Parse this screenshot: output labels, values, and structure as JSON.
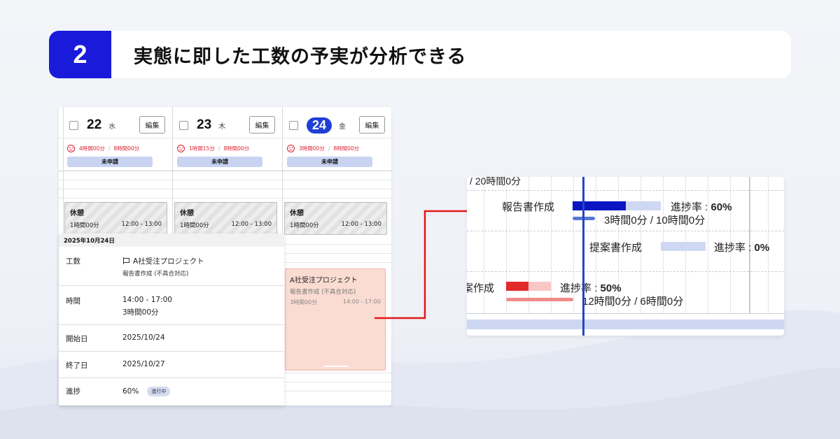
{
  "banner": {
    "number": "2",
    "title": "実態に即した工数の予実が分析できる"
  },
  "calendar": {
    "days": [
      {
        "num": "22",
        "dow": "水",
        "edit": "編集",
        "actual": "4時間00分",
        "planned": "8時間00分",
        "status": "未申請",
        "today": false
      },
      {
        "num": "23",
        "dow": "木",
        "edit": "編集",
        "actual": "1時間15分",
        "planned": "8時間00分",
        "status": "未申請",
        "today": false
      },
      {
        "num": "24",
        "dow": "金",
        "edit": "編集",
        "actual": "3時間00分",
        "planned": "8時間00分",
        "status": "未申請",
        "today": true
      }
    ],
    "rest": {
      "title": "休憩",
      "duration": "1時間00分",
      "range": "12:00 - 13:00"
    },
    "task": {
      "project": "A社受注プロジェクト",
      "name": "報告書作成 (不具合対応)",
      "duration": "3時間00分",
      "range": "14:00 - 17:00"
    }
  },
  "detail": {
    "date": "2025年10月24日",
    "rows": {
      "kosu": {
        "label": "工数",
        "project": "A社受注プロジェクト",
        "task": "報告書作成 (不具合対応)"
      },
      "time": {
        "label": "時間",
        "range": "14:00 - 17:00",
        "duration": "3時間00分"
      },
      "start": {
        "label": "開始日",
        "value": "2025/10/24"
      },
      "end": {
        "label": "終了日",
        "value": "2025/10/27"
      },
      "progress": {
        "label": "進捗",
        "value": "60%",
        "badge": "進行中"
      }
    }
  },
  "gantt": {
    "top_cut": "/ 20時間0分",
    "tasks": [
      {
        "name": "報告書作成",
        "progress_label": "進捗率 : ",
        "progress_value": "60%",
        "hours": "3時間0分 / 10時間0分",
        "progress": 0.6,
        "color": "#0a16c2",
        "track": "#cfd8f2",
        "sub": "#5578d6"
      },
      {
        "name": "提案書作成",
        "progress_label": "進捗率 : ",
        "progress_value": "0%",
        "progress": 0.0,
        "color": "#0a16c2",
        "track": "#cfd8f2"
      },
      {
        "name": "案作成",
        "progress_label": "進捗率 : ",
        "progress_value": "50%",
        "hours": "12時間0分 / 6時間0分",
        "progress": 0.5,
        "color": "#e22a2a",
        "track": "#f8c8c8",
        "sub": "#f08b8b"
      }
    ],
    "colors": {
      "today_line": "#2644c4",
      "bottom_bar": "#cdd7f2"
    }
  },
  "colors": {
    "brand": "#1a1adb",
    "accent_red": "#e21818",
    "today_badge": "#1f3fd6"
  }
}
